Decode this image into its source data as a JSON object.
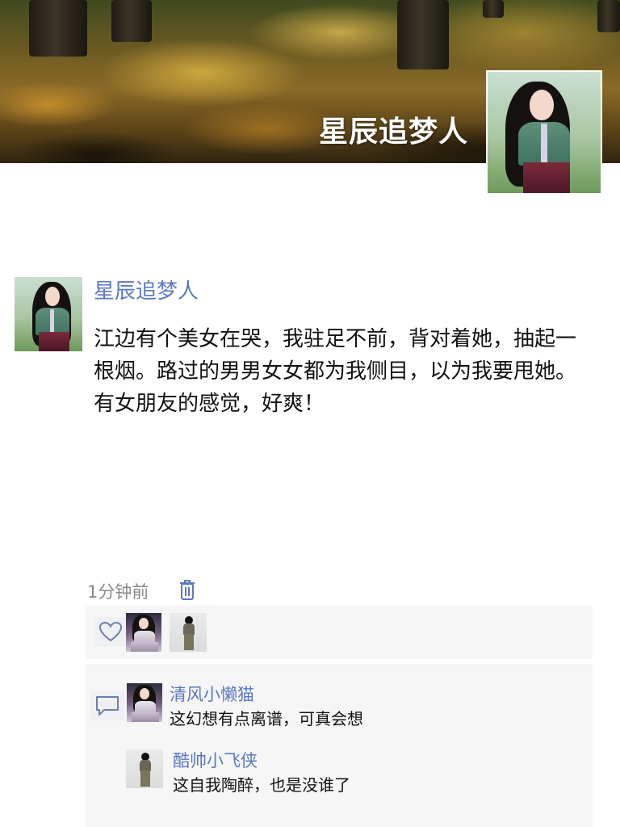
{
  "cover": {
    "title": "星辰追梦人"
  },
  "post": {
    "author": "星辰追梦人",
    "text": "江边有个美女在哭，我驻足不前，背对着她，抽起一根烟。路过的男男女女都为我侧目，以为我要甩她。有女朋友的感觉，好爽！",
    "time": "1分钟前"
  },
  "likes": {
    "count_avatars": 2
  },
  "comments": [
    {
      "author": "清风小懒猫",
      "text": "这幻想有点离谱，可真会想"
    },
    {
      "author": "酷帅小飞侠",
      "text": "这自我陶醉，也是没谁了"
    }
  ],
  "colors": {
    "name_link": "#5b78c0",
    "panel_bg": "#f6f6f7",
    "meta_text": "#888888"
  },
  "icons": [
    "trash-icon",
    "heart-icon",
    "comment-icon"
  ]
}
